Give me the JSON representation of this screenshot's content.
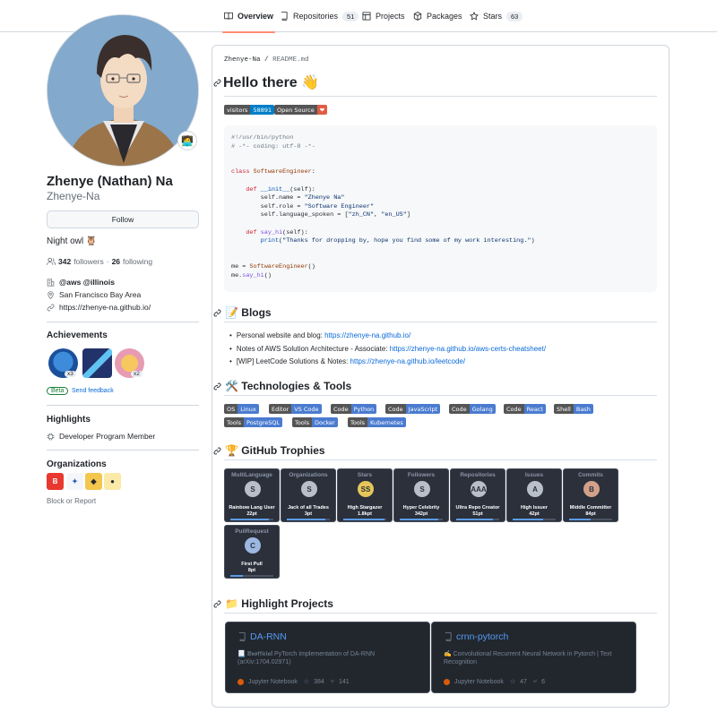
{
  "nav": {
    "tabs": [
      {
        "label": "Overview",
        "count": ""
      },
      {
        "label": "Repositories",
        "count": "51"
      },
      {
        "label": "Projects",
        "count": ""
      },
      {
        "label": "Packages",
        "count": ""
      },
      {
        "label": "Stars",
        "count": "63"
      }
    ]
  },
  "profile": {
    "fullname": "Zhenye (Nathan) Na",
    "username": "Zhenye-Na",
    "follow_label": "Follow",
    "bio": "Night owl 🦉",
    "followers": "342",
    "followers_label": "followers",
    "following": "26",
    "following_label": "following",
    "company": "@aws @illinois",
    "location": "San Francisco Bay Area",
    "website": "https://zhenye-na.github.io/"
  },
  "achievements": {
    "title": "Achievements",
    "badges": [
      "x3",
      "x2"
    ],
    "beta": "Beta",
    "feedback": "Send feedback"
  },
  "highlights": {
    "title": "Highlights",
    "item": "Developer Program Member"
  },
  "organizations": {
    "title": "Organizations",
    "block": "Block or Report"
  },
  "readme": {
    "path_user": "Zhenye-Na",
    "path_sep": "/",
    "path_file": "README.md",
    "h1": "Hello there 👋",
    "shields_top": [
      {
        "left": "visitors",
        "right": "58891",
        "lc": "#555555",
        "rc": "#007ec6"
      },
      {
        "left": "Open Source",
        "right": "❤",
        "lc": "#555555",
        "rc": "#e05d44"
      }
    ],
    "blogs_title": "📝 Blogs",
    "blogs": [
      {
        "text": "Personal website and blog: ",
        "link": "https://zhenye-na.github.io/"
      },
      {
        "text": "Notes of AWS Solution Architecture - Associate: ",
        "link": "https://zhenye-na.github.io/aws-certs-cheatsheet/"
      },
      {
        "text": "[WIP] LeetCode Solutions & Notes: ",
        "link": "https://zhenye-na.github.io/leetcode/"
      }
    ],
    "tech_title": "🛠️ Technologies & Tools",
    "tech_row1": [
      {
        "left": "OS",
        "right": "Linux"
      },
      {
        "left": "Editor",
        "right": "VS Code"
      },
      {
        "left": "Code",
        "right": "Python"
      },
      {
        "left": "Code",
        "right": "JavaScript"
      },
      {
        "left": "Code",
        "right": "Golang"
      },
      {
        "left": "Code",
        "right": "React"
      },
      {
        "left": "Shell",
        "right": "Bash"
      }
    ],
    "tech_row2": [
      {
        "left": "Tools",
        "right": "PostgreSQL"
      },
      {
        "left": "Tools",
        "right": "Docker"
      },
      {
        "left": "Tools",
        "right": "Kubernetes"
      }
    ],
    "trophies_title": "🏆 GitHub Trophies",
    "trophies": [
      {
        "title": "MultiLanguage",
        "rank": "S",
        "name": "Rainbow Lang User",
        "points": "22pt",
        "progress": 0.9
      },
      {
        "title": "Organizations",
        "rank": "S",
        "name": "Jack of all Trades",
        "points": "3pt",
        "progress": 0.9
      },
      {
        "title": "Stars",
        "rank": "SS",
        "name": "High Stargazer",
        "points": "1.8kpt",
        "progress": 0.95
      },
      {
        "title": "Followers",
        "rank": "S",
        "name": "Hyper Celebrity",
        "points": "342pt",
        "progress": 0.9
      },
      {
        "title": "Repositories",
        "rank": "AAA",
        "name": "Ultra Repo Creator",
        "points": "51pt",
        "progress": 0.85
      },
      {
        "title": "Issues",
        "rank": "A",
        "name": "High Issuer",
        "points": "42pt",
        "progress": 0.7
      },
      {
        "title": "Commits",
        "rank": "B",
        "name": "Middle Committer",
        "points": "84pt",
        "progress": 0.5
      },
      {
        "title": "PullRequest",
        "rank": "C",
        "name": "First Pull",
        "points": "8pt",
        "progress": 0.3
      }
    ],
    "projects_title": "📁 Highlight Projects",
    "projects": [
      {
        "name": "DA-RNN",
        "desc": "📃 𝖀𝖓𝖔𝖋𝖋𝖎𝖈𝖎𝖆𝖑 PyTorch Implementation of DA-RNN (arXiv:1704.02971)",
        "lang": "Jupyter Notebook",
        "stars": "384",
        "forks": "141"
      },
      {
        "name": "crnn-pytorch",
        "desc": "✍️ Convolutional Recurrent Neural Network in Pytorch | Text Recognition",
        "lang": "Jupyter Notebook",
        "stars": "47",
        "forks": "6"
      }
    ]
  }
}
